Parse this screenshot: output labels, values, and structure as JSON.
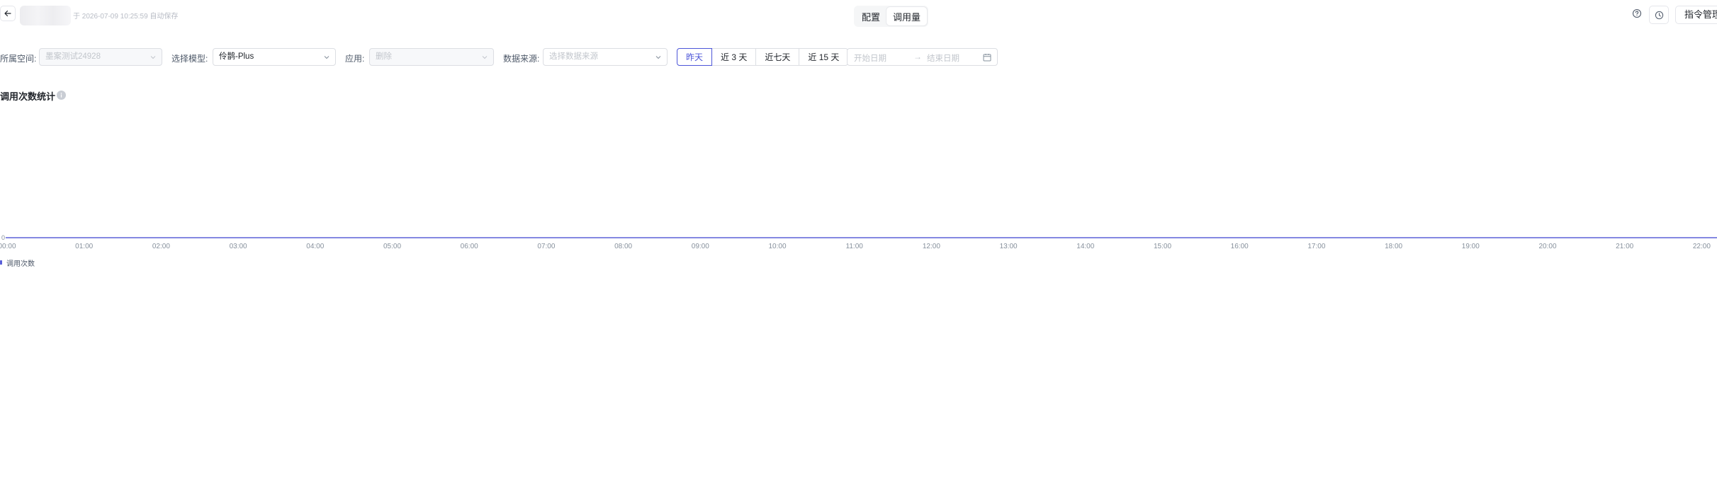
{
  "header": {
    "save_status": "于 2026-07-09 10:25:59 自动保存",
    "tabs": [
      {
        "label": "配置",
        "active": false
      },
      {
        "label": "调用量",
        "active": true
      }
    ],
    "command_button": "指令管理"
  },
  "filters": {
    "workspace": {
      "label": "所属空间:",
      "value": "墨案测试24928",
      "disabled": true
    },
    "model": {
      "label": "选择模型:",
      "value": "伶鹊-Plus",
      "disabled": false
    },
    "app": {
      "label": "应用:",
      "value": "删除",
      "disabled": true
    },
    "source": {
      "label": "数据来源:",
      "placeholder": "选择数据来源"
    },
    "ranges": [
      {
        "label": "昨天",
        "active": true
      },
      {
        "label": "近 3 天",
        "active": false
      },
      {
        "label": "近七天",
        "active": false
      },
      {
        "label": "近 15 天",
        "active": false
      }
    ],
    "date_range": {
      "start_placeholder": "开始日期",
      "separator": "→",
      "end_placeholder": "结束日期"
    }
  },
  "section": {
    "title": "调用次数统计"
  },
  "accent_color": "#4c55d8",
  "chart_data": {
    "type": "line",
    "title": "",
    "x": [
      "00:00",
      "01:00",
      "02:00",
      "03:00",
      "04:00",
      "05:00",
      "06:00",
      "07:00",
      "08:00",
      "09:00",
      "10:00",
      "11:00",
      "12:00",
      "13:00",
      "14:00",
      "15:00",
      "16:00",
      "17:00",
      "18:00",
      "19:00",
      "20:00",
      "21:00",
      "22:00"
    ],
    "series": [
      {
        "name": "调用次数",
        "color": "#5b61d9",
        "values": [
          0,
          0,
          0,
          0,
          0,
          0,
          0,
          0,
          0,
          0,
          0,
          0,
          0,
          0,
          0,
          0,
          0,
          0,
          0,
          0,
          0,
          0,
          0
        ]
      }
    ],
    "y_ticks": [
      "0"
    ],
    "legend_position": "bottom-left",
    "grid": false
  }
}
